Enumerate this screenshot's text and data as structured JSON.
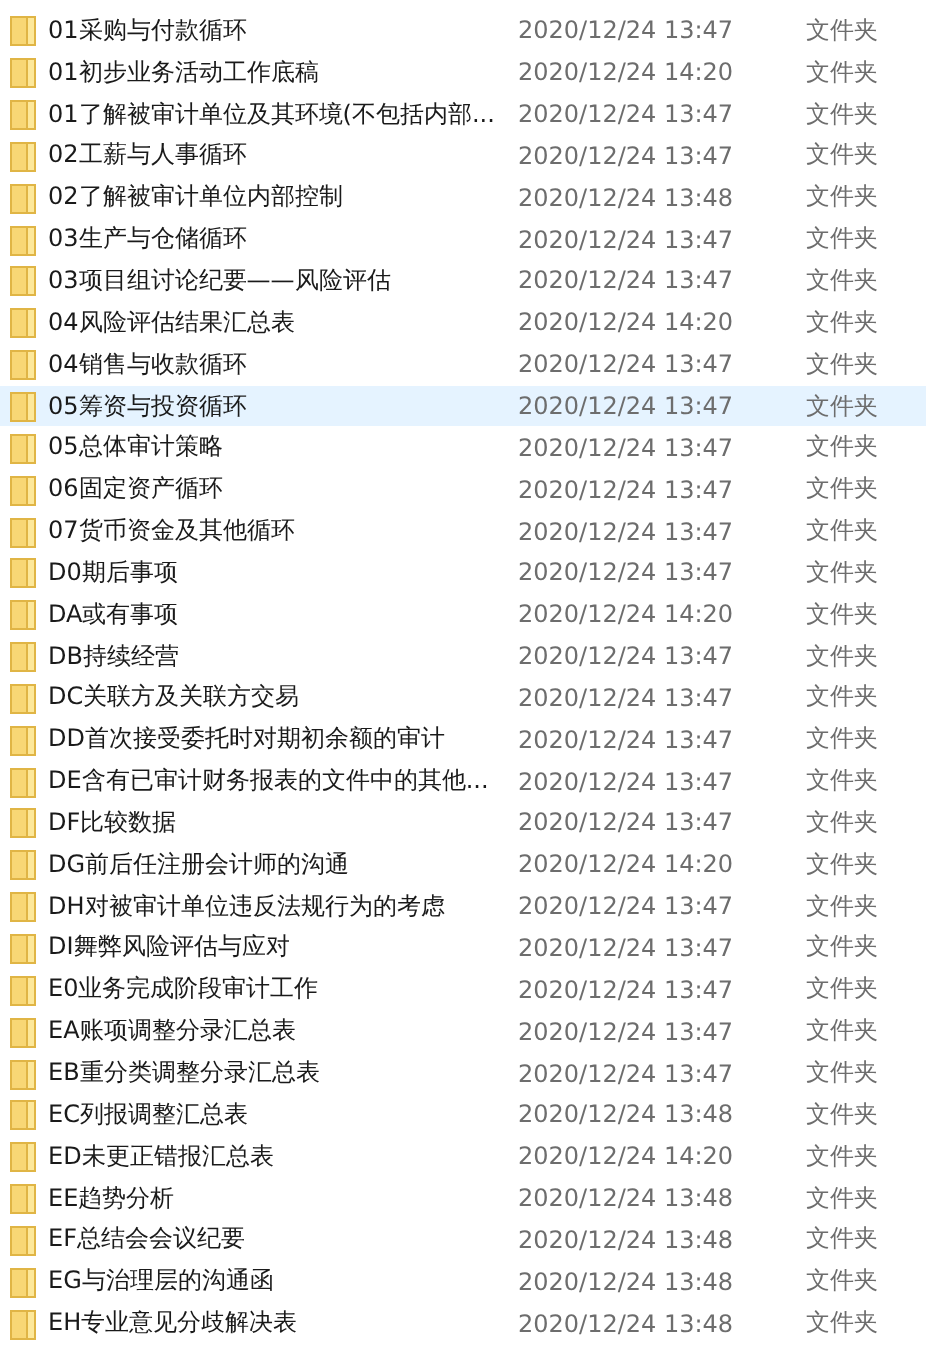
{
  "files": [
    {
      "name": "01采购与付款循环",
      "modified": "2020/12/24 13:47",
      "type": "文件夹",
      "hovered": false
    },
    {
      "name": "01初步业务活动工作底稿",
      "modified": "2020/12/24 14:20",
      "type": "文件夹",
      "hovered": false
    },
    {
      "name": "01了解被审计单位及其环境(不包括内部...",
      "modified": "2020/12/24 13:47",
      "type": "文件夹",
      "hovered": false
    },
    {
      "name": "02工薪与人事循环",
      "modified": "2020/12/24 13:47",
      "type": "文件夹",
      "hovered": false
    },
    {
      "name": "02了解被审计单位内部控制",
      "modified": "2020/12/24 13:48",
      "type": "文件夹",
      "hovered": false
    },
    {
      "name": "03生产与仓储循环",
      "modified": "2020/12/24 13:47",
      "type": "文件夹",
      "hovered": false
    },
    {
      "name": "03项目组讨论纪要——风险评估",
      "modified": "2020/12/24 13:47",
      "type": "文件夹",
      "hovered": false
    },
    {
      "name": "04风险评估结果汇总表",
      "modified": "2020/12/24 14:20",
      "type": "文件夹",
      "hovered": false
    },
    {
      "name": "04销售与收款循环",
      "modified": "2020/12/24 13:47",
      "type": "文件夹",
      "hovered": false
    },
    {
      "name": "05筹资与投资循环",
      "modified": "2020/12/24 13:47",
      "type": "文件夹",
      "hovered": true
    },
    {
      "name": "05总体审计策略",
      "modified": "2020/12/24 13:47",
      "type": "文件夹",
      "hovered": false
    },
    {
      "name": "06固定资产循环",
      "modified": "2020/12/24 13:47",
      "type": "文件夹",
      "hovered": false
    },
    {
      "name": "07货币资金及其他循环",
      "modified": "2020/12/24 13:47",
      "type": "文件夹",
      "hovered": false
    },
    {
      "name": "D0期后事项",
      "modified": "2020/12/24 13:47",
      "type": "文件夹",
      "hovered": false
    },
    {
      "name": "DA或有事项",
      "modified": "2020/12/24 14:20",
      "type": "文件夹",
      "hovered": false
    },
    {
      "name": "DB持续经营",
      "modified": "2020/12/24 13:47",
      "type": "文件夹",
      "hovered": false
    },
    {
      "name": "DC关联方及关联方交易",
      "modified": "2020/12/24 13:47",
      "type": "文件夹",
      "hovered": false
    },
    {
      "name": "DD首次接受委托时对期初余额的审计",
      "modified": "2020/12/24 13:47",
      "type": "文件夹",
      "hovered": false
    },
    {
      "name": "DE含有已审计财务报表的文件中的其他...",
      "modified": "2020/12/24 13:47",
      "type": "文件夹",
      "hovered": false
    },
    {
      "name": "DF比较数据",
      "modified": "2020/12/24 13:47",
      "type": "文件夹",
      "hovered": false
    },
    {
      "name": "DG前后任注册会计师的沟通",
      "modified": "2020/12/24 14:20",
      "type": "文件夹",
      "hovered": false
    },
    {
      "name": "DH对被审计单位违反法规行为的考虑",
      "modified": "2020/12/24 13:47",
      "type": "文件夹",
      "hovered": false
    },
    {
      "name": "DI舞弊风险评估与应对",
      "modified": "2020/12/24 13:47",
      "type": "文件夹",
      "hovered": false
    },
    {
      "name": "E0业务完成阶段审计工作",
      "modified": "2020/12/24 13:47",
      "type": "文件夹",
      "hovered": false
    },
    {
      "name": "EA账项调整分录汇总表",
      "modified": "2020/12/24 13:47",
      "type": "文件夹",
      "hovered": false
    },
    {
      "name": "EB重分类调整分录汇总表",
      "modified": "2020/12/24 13:47",
      "type": "文件夹",
      "hovered": false
    },
    {
      "name": "EC列报调整汇总表",
      "modified": "2020/12/24 13:48",
      "type": "文件夹",
      "hovered": false
    },
    {
      "name": "ED未更正错报汇总表",
      "modified": "2020/12/24 14:20",
      "type": "文件夹",
      "hovered": false
    },
    {
      "name": "EE趋势分析",
      "modified": "2020/12/24 13:48",
      "type": "文件夹",
      "hovered": false
    },
    {
      "name": "EF总结会会议纪要",
      "modified": "2020/12/24 13:48",
      "type": "文件夹",
      "hovered": false
    },
    {
      "name": "EG与治理层的沟通函",
      "modified": "2020/12/24 13:48",
      "type": "文件夹",
      "hovered": false
    },
    {
      "name": "EH专业意见分歧解决表",
      "modified": "2020/12/24 13:48",
      "type": "文件夹",
      "hovered": false
    }
  ]
}
